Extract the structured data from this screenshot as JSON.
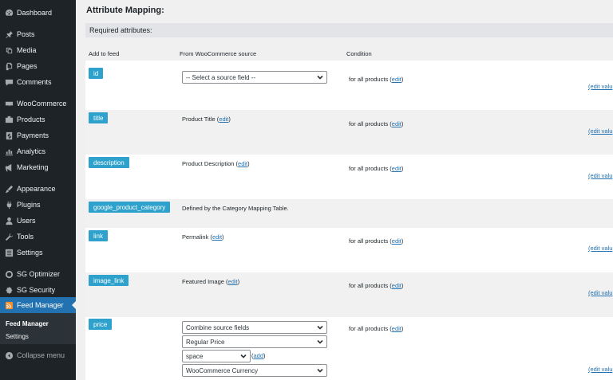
{
  "sidebar": {
    "items": [
      {
        "label": "Dashboard",
        "icon": "dashboard-icon"
      },
      {
        "label": "Posts",
        "icon": "pin-icon"
      },
      {
        "label": "Media",
        "icon": "media-icon"
      },
      {
        "label": "Pages",
        "icon": "pages-icon"
      },
      {
        "label": "Comments",
        "icon": "comments-icon"
      },
      {
        "label": "WooCommerce",
        "icon": "woocommerce-icon"
      },
      {
        "label": "Products",
        "icon": "products-icon"
      },
      {
        "label": "Payments",
        "icon": "payments-icon"
      },
      {
        "label": "Analytics",
        "icon": "analytics-icon"
      },
      {
        "label": "Marketing",
        "icon": "marketing-icon"
      },
      {
        "label": "Appearance",
        "icon": "appearance-icon"
      },
      {
        "label": "Plugins",
        "icon": "plugins-icon"
      },
      {
        "label": "Users",
        "icon": "users-icon"
      },
      {
        "label": "Tools",
        "icon": "tools-icon"
      },
      {
        "label": "Settings",
        "icon": "settings-icon"
      },
      {
        "label": "SG Optimizer",
        "icon": "sg-optimizer-icon"
      },
      {
        "label": "SG Security",
        "icon": "sg-security-icon"
      },
      {
        "label": "Feed Manager",
        "icon": "feed-icon"
      }
    ],
    "submenu": [
      {
        "label": "Feed Manager"
      },
      {
        "label": "Settings"
      }
    ],
    "collapse_label": "Collapse menu"
  },
  "main": {
    "title": "Attribute Mapping:",
    "required_label": "Required attributes:",
    "columns": {
      "add_to_feed": "Add to feed",
      "source": "From WooCommerce source",
      "condition": "Condition"
    },
    "rows": [
      {
        "attr": "id",
        "select": "-- Select a source field --",
        "condition": "for all products",
        "edit": "edit",
        "edit_value": "(edit valu"
      },
      {
        "attr": "title",
        "source": "Product Title",
        "edit": "edit",
        "condition": "for all products",
        "edit_value": "(edit valu"
      },
      {
        "attr": "description",
        "source": "Product Description",
        "edit": "edit",
        "condition": "for all products",
        "edit_value": "(edit valu"
      },
      {
        "attr": "google_product_category",
        "source": "Defined by the Category Mapping Table."
      },
      {
        "attr": "link",
        "source": "Permalink",
        "edit": "edit",
        "condition": "for all products",
        "edit_value": "(edit valu"
      },
      {
        "attr": "image_link",
        "source": "Featured Image",
        "edit": "edit",
        "condition": "for all products",
        "edit_value": "(edit valu"
      },
      {
        "attr": "price",
        "selects": [
          "Combine source fields",
          "Regular Price",
          "space",
          "WooCommerce Currency"
        ],
        "add": "add",
        "condition": "for all products",
        "edit": "edit",
        "edit_value": "(edit valu"
      }
    ]
  },
  "colors": {
    "sidebar_bg": "#1d2327",
    "active_menu": "#2271b1",
    "tag_bg": "#2ea2cc",
    "link": "#2271b1"
  }
}
